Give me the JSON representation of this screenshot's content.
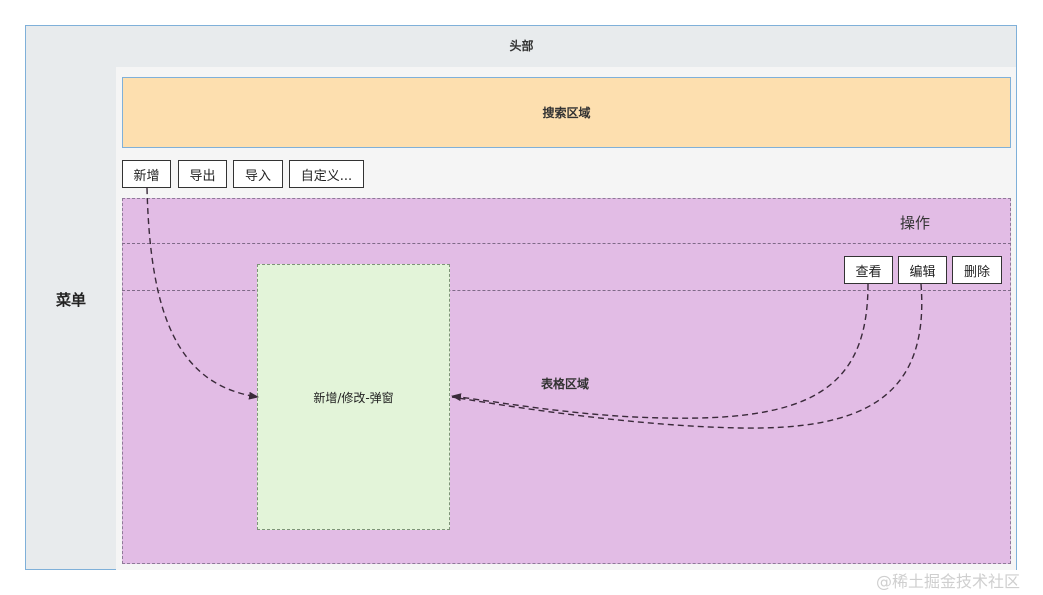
{
  "header": {
    "label": "头部"
  },
  "menu": {
    "label": "菜单"
  },
  "search": {
    "label": "搜索区域"
  },
  "toolbar": {
    "buttons": [
      {
        "label": "新增"
      },
      {
        "label": "导出"
      },
      {
        "label": "导入"
      },
      {
        "label": "自定义..."
      }
    ]
  },
  "table": {
    "label": "表格区域",
    "operations_label": "操作",
    "row_buttons": [
      {
        "label": "查看"
      },
      {
        "label": "编辑"
      },
      {
        "label": "删除"
      }
    ]
  },
  "dialog": {
    "label": "新增/修改-弹窗"
  },
  "watermark": {
    "text": "@稀土掘金技术社区"
  },
  "colors": {
    "search_bg": "#fddfaf",
    "table_bg": "#e2bce5",
    "dialog_bg": "#e3f4d9",
    "frame_border": "#7fb0d9",
    "arrow": "#3a2a3a"
  }
}
